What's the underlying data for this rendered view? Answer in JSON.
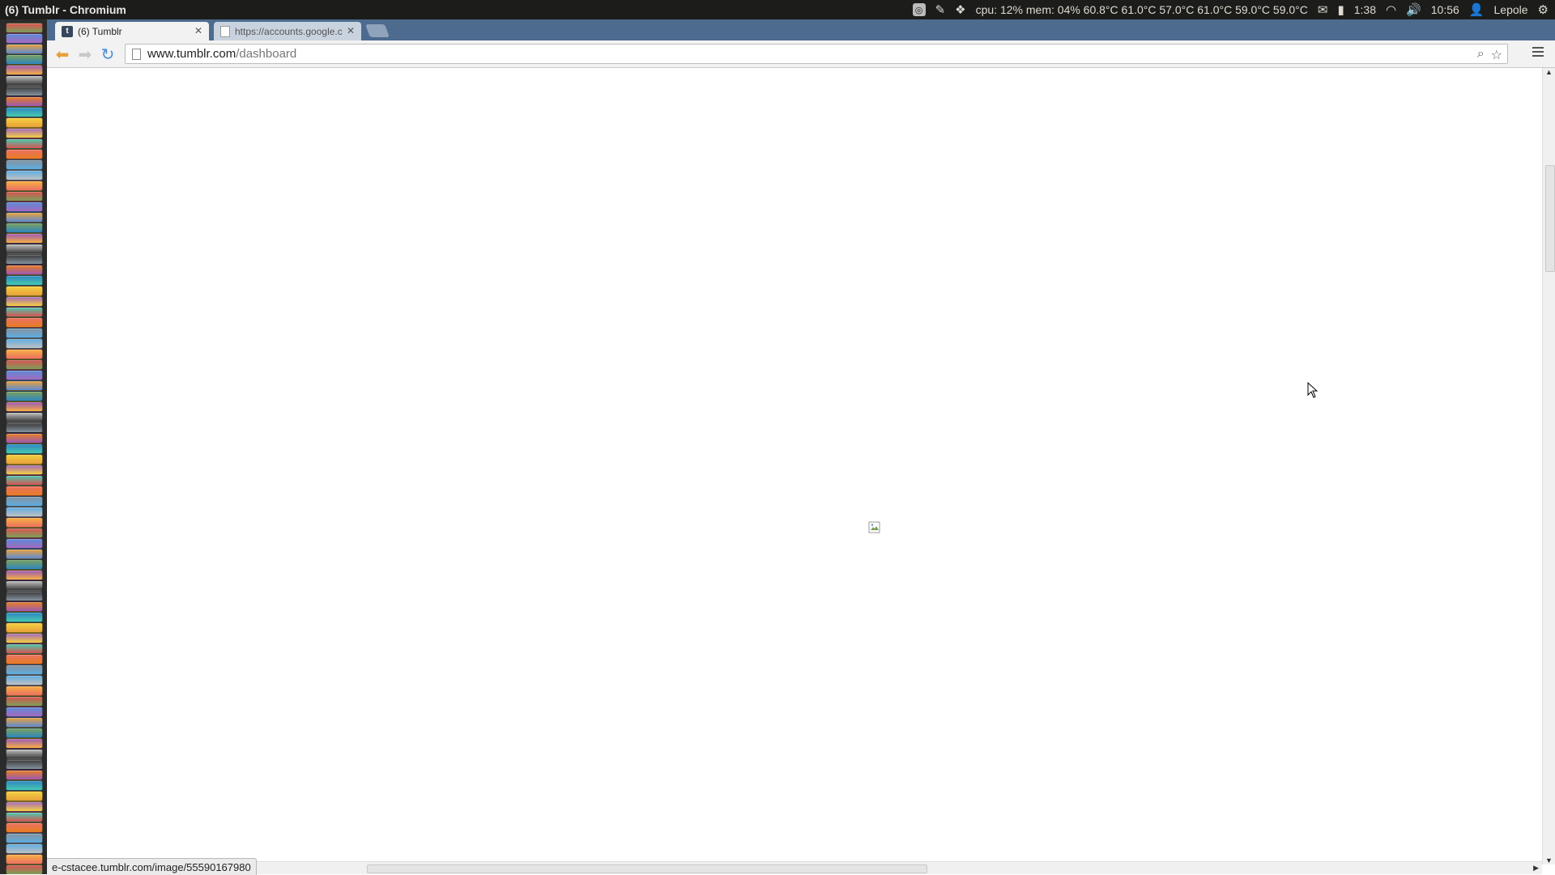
{
  "topbar": {
    "window_title": "(6) Tumblr - Chromium",
    "system_stats": "cpu: 12% mem: 04% 60.8°C 61.0°C 57.0°C 61.0°C 59.0°C 59.0°C",
    "battery_time": "1:38",
    "clock": "10:56",
    "user": "Lepole"
  },
  "tabs": [
    {
      "label": "(6) Tumblr",
      "icon": "tumblr-favicon"
    },
    {
      "label": "https://accounts.google.c",
      "icon": "document-favicon"
    }
  ],
  "address": {
    "host": "www.tumblr.com",
    "path": "/dashboard"
  },
  "status_bar": {
    "url": "e-cstacee.tumblr.com/image/55590167980"
  },
  "colors": {
    "tabstrip": "#4c6b8f",
    "topbar": "#1c1c1a",
    "launcher": "#2b2b2b"
  }
}
